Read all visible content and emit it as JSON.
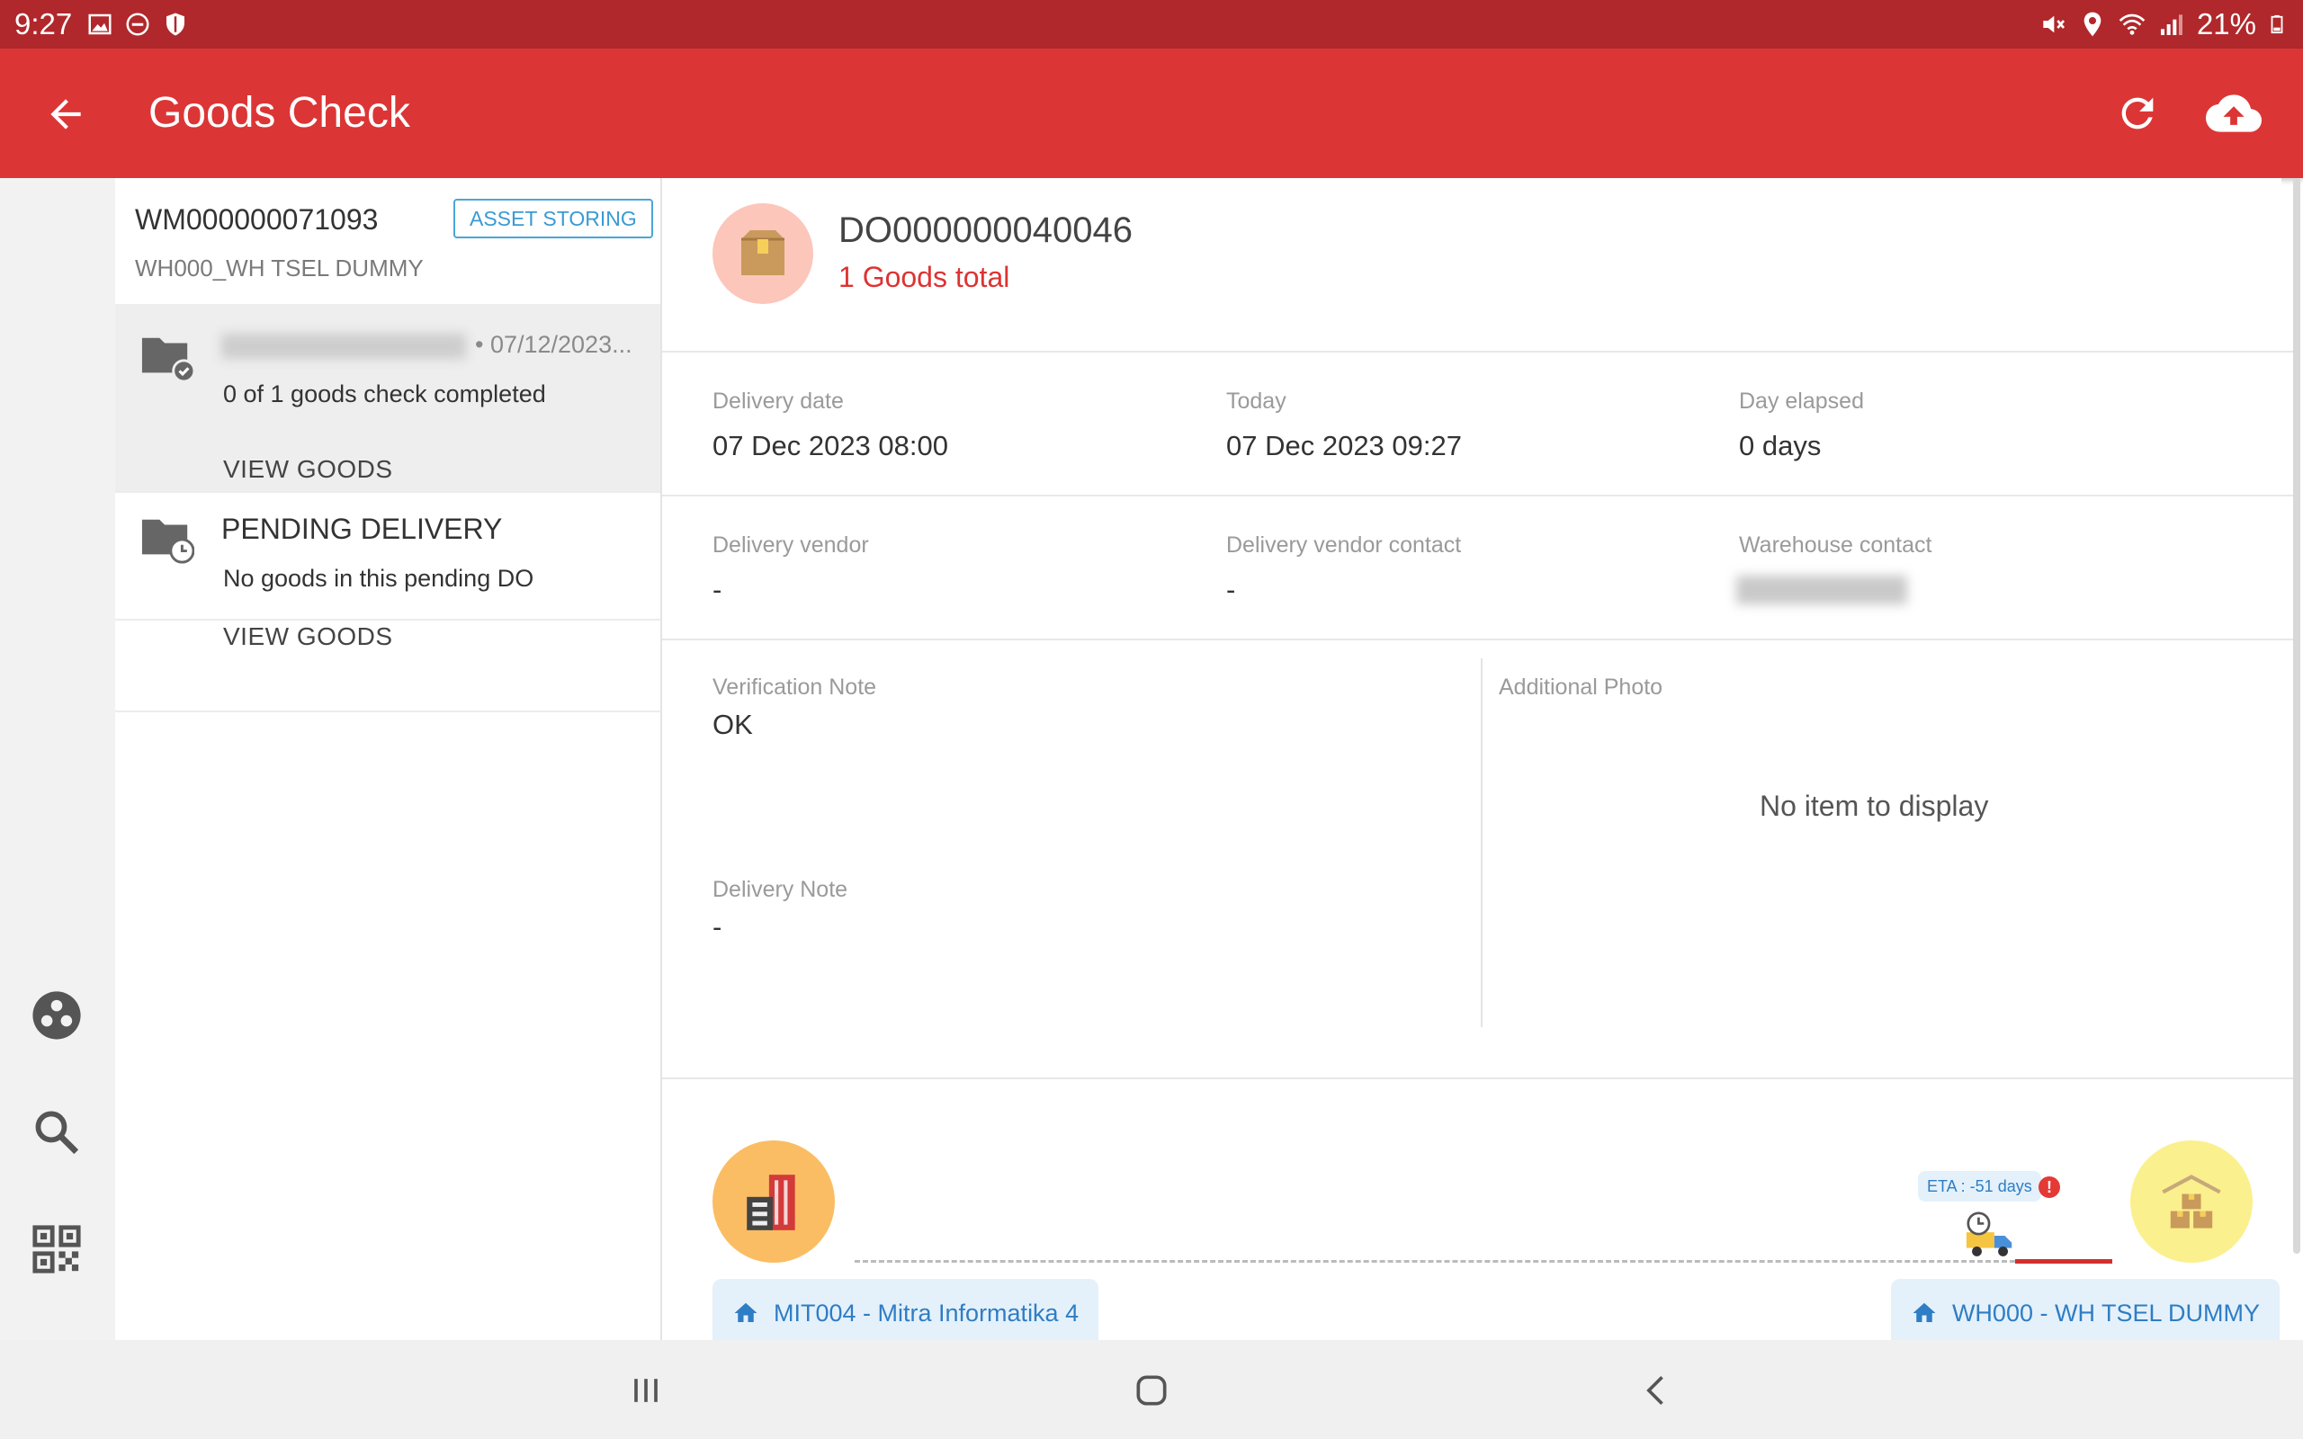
{
  "status_bar": {
    "time": "9:27",
    "battery": "21%"
  },
  "app_bar": {
    "title": "Goods Check"
  },
  "warehouse": {
    "id": "WM000000071093",
    "badge": "ASSET STORING",
    "name": "WH000_WH TSEL DUMMY"
  },
  "list": {
    "items": [
      {
        "date": "• 07/12/2023...",
        "progress_text": "0 of  1 goods check completed",
        "action": "VIEW GOODS"
      },
      {
        "title": "PENDING DELIVERY",
        "subtitle": "No goods in this pending DO",
        "action": "VIEW GOODS"
      }
    ]
  },
  "detail": {
    "do_id": "DO000000040046",
    "goods_total": "1 Goods total",
    "fields": {
      "delivery_date_label": "Delivery date",
      "delivery_date": "07 Dec 2023 08:00",
      "today_label": "Today",
      "today": "07 Dec 2023 09:27",
      "day_elapsed_label": "Day elapsed",
      "day_elapsed": "0 days",
      "vendor_label": "Delivery vendor",
      "vendor": "-",
      "vendor_contact_label": "Delivery vendor contact",
      "vendor_contact": "-",
      "warehouse_contact_label": "Warehouse contact",
      "verification_note_label": "Verification Note",
      "verification_note": "OK",
      "delivery_note_label": "Delivery Note",
      "delivery_note": "-",
      "additional_photo_label": "Additional Photo",
      "additional_photo_empty": "No item to display"
    },
    "route": {
      "eta": "ETA : -51 days",
      "alert": "!",
      "origin": "MIT004 - Mitra Informatika 4",
      "destination": "WH000 - WH TSEL DUMMY"
    }
  },
  "icons": {
    "back": "arrow-back-icon",
    "refresh": "refresh-icon",
    "upload": "cloud-upload-icon",
    "rail": [
      "group-icon",
      "search-icon",
      "qr-code-icon"
    ],
    "nav": [
      "recents-icon",
      "home-icon",
      "back-icon"
    ]
  },
  "colors": {
    "app_bar": "#dc3535",
    "status_bar": "#b0282b",
    "accent_red": "#d32f2f",
    "badge_blue": "#3a9ad4",
    "location_blue": "#2f7dc4"
  }
}
